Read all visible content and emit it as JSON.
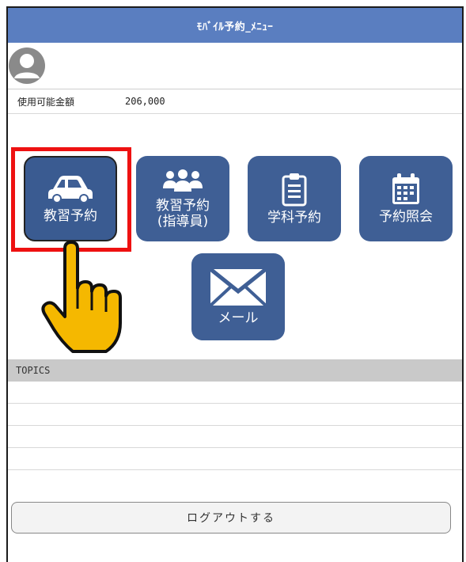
{
  "header": {
    "title": "ﾓﾊﾞｲﾙ予約_ﾒﾆｭｰ"
  },
  "user": {
    "avatar_icon": "user-avatar-icon"
  },
  "balance": {
    "label": "使用可能金額",
    "value": "206,000"
  },
  "menu": {
    "items": [
      {
        "label_line1": "教習予約",
        "label_line2": "",
        "icon": "car-icon"
      },
      {
        "label_line1": "教習予約",
        "label_line2": "(指導員)",
        "icon": "people-icon"
      },
      {
        "label_line1": "学科予約",
        "label_line2": "",
        "icon": "clipboard-icon"
      },
      {
        "label_line1": "予約照会",
        "label_line2": "",
        "icon": "calendar-icon"
      },
      {
        "label_line1": "メール",
        "label_line2": "",
        "icon": "mail-icon"
      }
    ]
  },
  "topics": {
    "title": "TOPICS"
  },
  "footer": {
    "logout_label": "ログアウトする"
  },
  "colors": {
    "header": "#5a7ec0",
    "tile": "#3f5f95",
    "highlight": "#ee1111",
    "hand": "#f5b800"
  }
}
